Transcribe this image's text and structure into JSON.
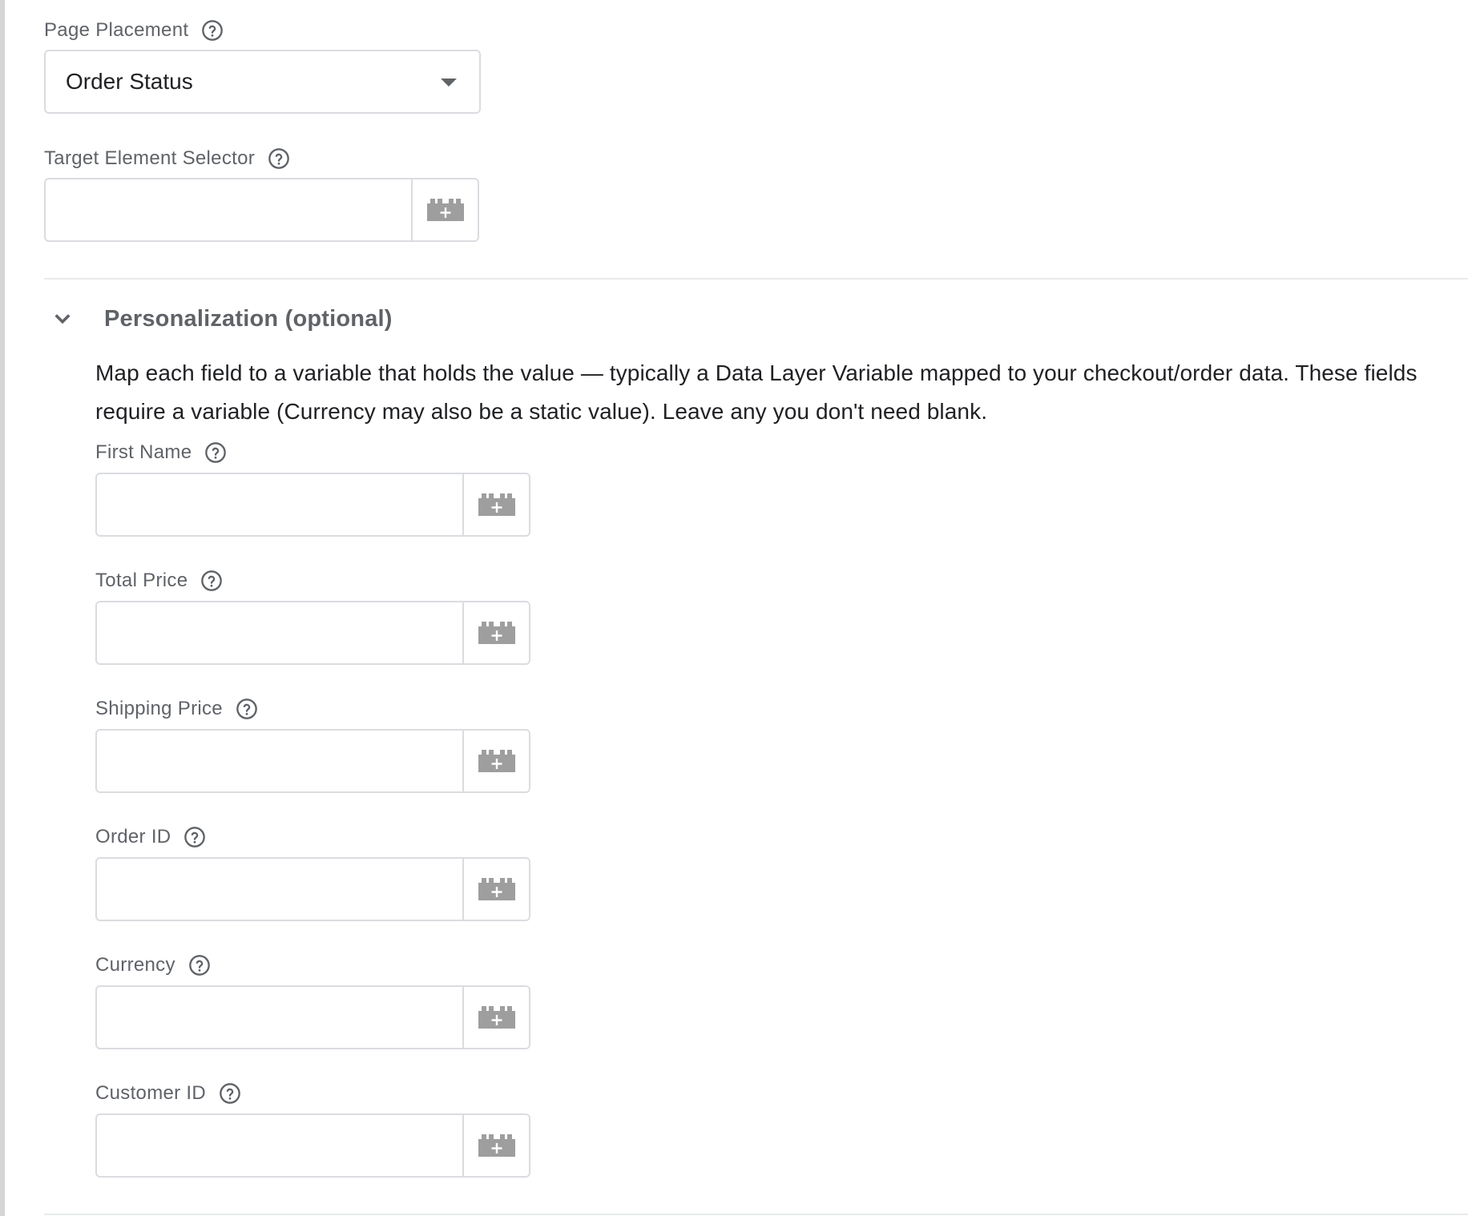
{
  "page_placement": {
    "label": "Page Placement",
    "selected_value": "Order Status"
  },
  "target_selector": {
    "label": "Target Element Selector",
    "value": ""
  },
  "personalization": {
    "title": "Personalization (optional)",
    "description": "Map each field to a variable that holds the value — typically a Data Layer Variable mapped to your checkout/order data. These fields require a variable (Currency may also be a static value). Leave any you don't need blank.",
    "fields": [
      {
        "label": "First Name",
        "value": ""
      },
      {
        "label": "Total Price",
        "value": ""
      },
      {
        "label": "Shipping Price",
        "value": ""
      },
      {
        "label": "Order ID",
        "value": ""
      },
      {
        "label": "Currency",
        "value": ""
      },
      {
        "label": "Customer ID",
        "value": ""
      }
    ]
  },
  "icons": {
    "help": "help-circle-icon",
    "variable": "variable-brick-plus-icon",
    "dropdown": "caret-down-icon",
    "collapse": "chevron-down-icon"
  },
  "colors": {
    "label": "#5f6368",
    "text": "#202124",
    "border": "#dadce0",
    "icon": "#9e9e9e"
  }
}
